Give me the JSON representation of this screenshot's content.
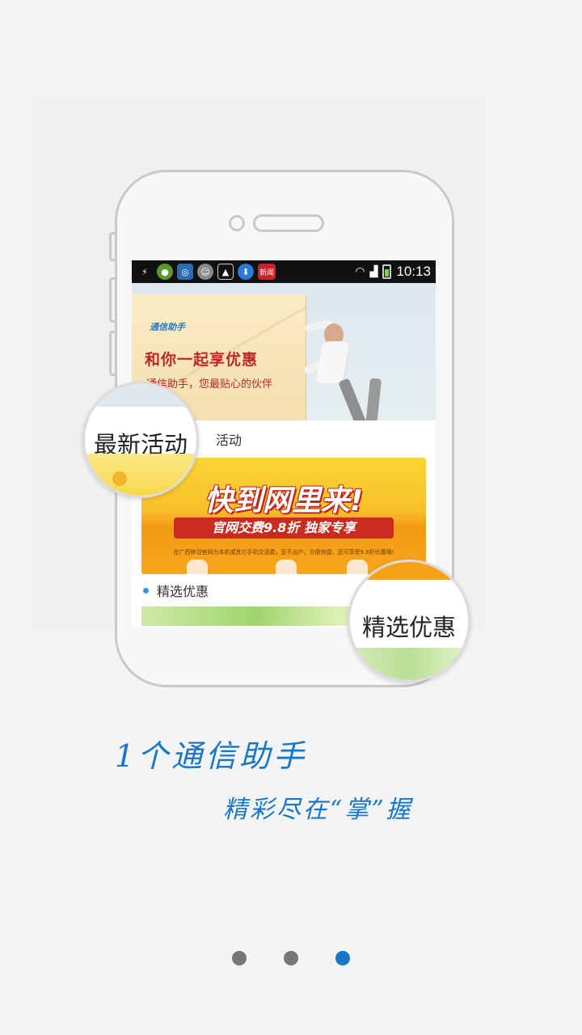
{
  "status_bar": {
    "time": "10:13",
    "news_badge": "新闻"
  },
  "banner": {
    "logo_text": "通信助手",
    "title": "和你一起享优惠",
    "subtitle": "通信助手，您最贴心的伙伴"
  },
  "sections": {
    "latest_label": "活动",
    "selected_label": "精选优惠"
  },
  "promo": {
    "title": "快到网里来!",
    "subtitle": "官网交费9.8折 独家专享",
    "note": "在广西移动官网为本机或其它手机交话费，足不出户，方便快捷，还可享受9.8折优惠哦!"
  },
  "magnifiers": {
    "latest": "最新活动",
    "selected": "精选优惠"
  },
  "slogans": {
    "line1": "1个通信助手",
    "line2": "精彩尽在“掌”握"
  },
  "pager": {
    "count": 3,
    "active_index": 2,
    "active_color": "#1677c8",
    "inactive_color": "#777777"
  }
}
